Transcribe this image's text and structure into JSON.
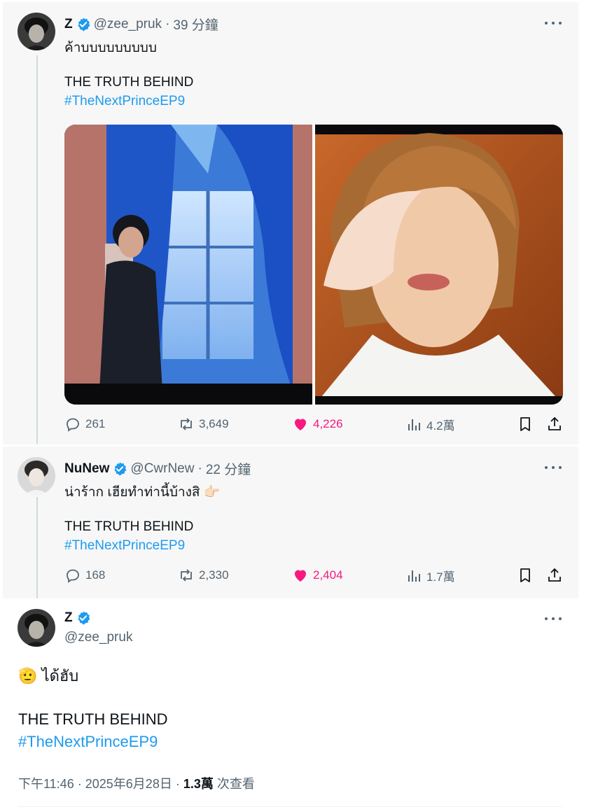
{
  "tweets": [
    {
      "name": "Z",
      "handle": "@zee_pruk",
      "dot": "·",
      "ago": "39 分鐘",
      "line1": "ค้าบบบบบบบบบ",
      "line2": "THE TRUTH BEHIND",
      "hashtag": "#TheNextPrinceEP9",
      "replies": "261",
      "retweets": "3,649",
      "likes": "4,226",
      "views": "4.2萬"
    },
    {
      "name": "NuNew",
      "handle": "@CwrNew",
      "dot": "·",
      "ago": "22 分鐘",
      "line1": "น่าร้าก เฮียทำท่านี้บ้างสิ",
      "line1_emoji": "👉🏻",
      "line2": "THE TRUTH BEHIND",
      "hashtag": "#TheNextPrinceEP9",
      "replies": "168",
      "retweets": "2,330",
      "likes": "2,404",
      "views": "1.7萬"
    }
  ],
  "main_tweet": {
    "name": "Z",
    "handle": "@zee_pruk",
    "emoji": "🫡",
    "line1": "ได้ฮับ",
    "line2": "THE TRUTH BEHIND",
    "hashtag": "#TheNextPrinceEP9",
    "time": "下午11:46",
    "dot1": "·",
    "date": "2025年6月28日",
    "dot2": "·",
    "views_count": "1.3萬",
    "views_label": "次查看"
  },
  "icons": [
    "verified-badge-icon",
    "more-icon",
    "reply-icon",
    "retweet-icon",
    "heart-icon",
    "views-icon",
    "bookmark-icon",
    "share-icon"
  ],
  "colors": {
    "link": "#1d9bf0",
    "like": "#f91880",
    "muted": "#536471",
    "tweet_bg": "#f7f7f7",
    "thread_line": "#cfd9de"
  }
}
